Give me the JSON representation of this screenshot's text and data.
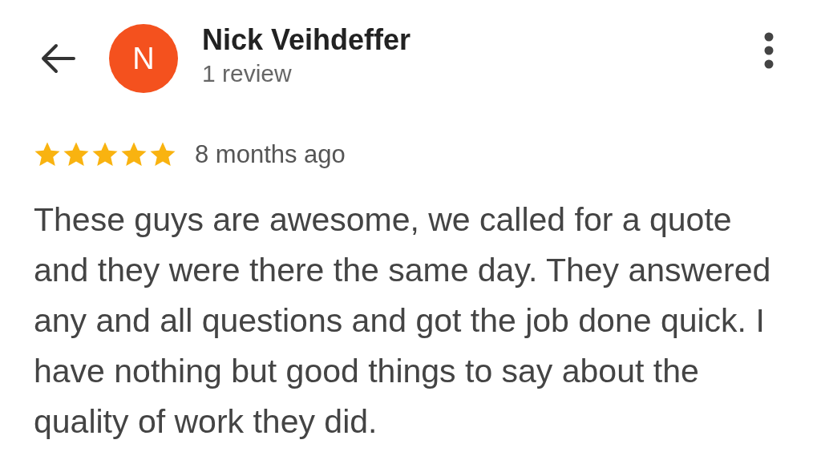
{
  "reviewer": {
    "initial": "N",
    "name": "Nick Veihdeffer",
    "review_count": "1 review"
  },
  "review": {
    "stars": 5,
    "time": "8 months ago",
    "text": "These guys are awesome, we called for a quote and they were there the same day. They answered any and all questions and got the job done quick. I have nothing but good things to say about the quality of work they did."
  }
}
